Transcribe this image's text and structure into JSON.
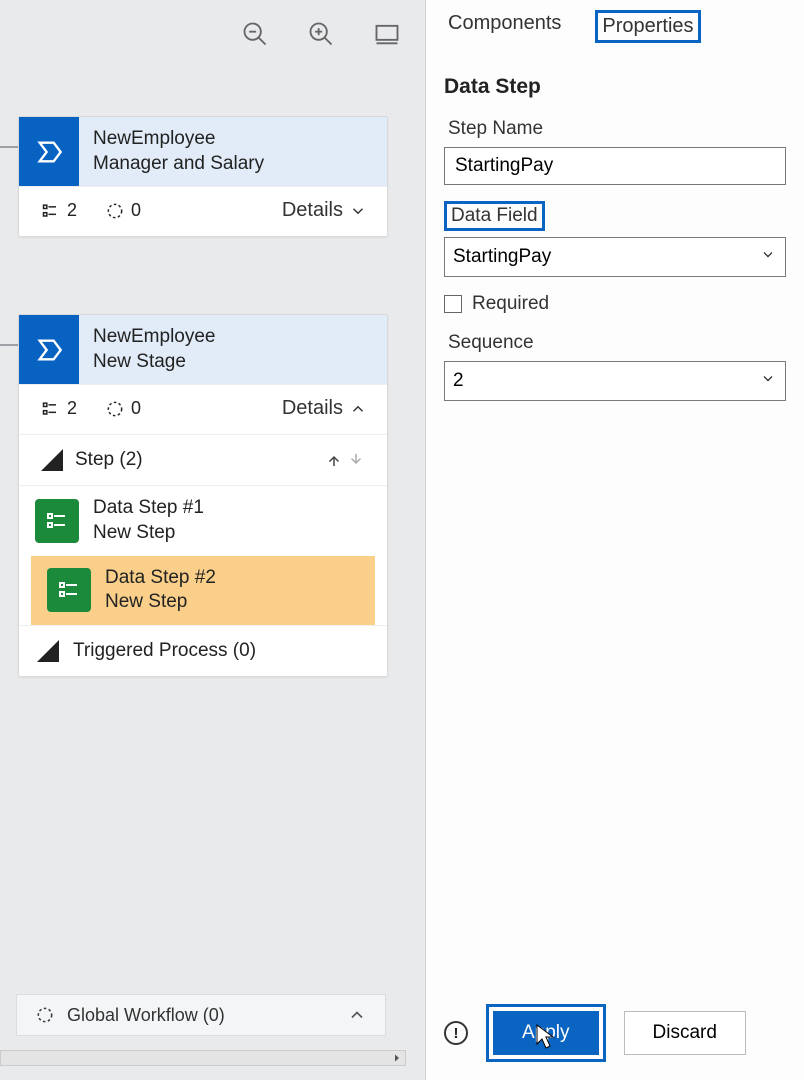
{
  "toolbar": {
    "zoom_out": "zoom-out",
    "zoom_in": "zoom-in",
    "fit": "fit"
  },
  "stages": [
    {
      "title1": "NewEmployee",
      "title2": "Manager and Salary",
      "steps_count": "2",
      "cycle_count": "0",
      "details_label": "Details"
    },
    {
      "title1": "NewEmployee",
      "title2": "New Stage",
      "steps_count": "2",
      "cycle_count": "0",
      "details_label": "Details",
      "step_header": "Step (2)",
      "data_step1_title": "Data Step #1",
      "data_step1_sub": "New Step",
      "data_step2_title": "Data Step #2",
      "data_step2_sub": "New Step",
      "triggered": "Triggered Process (0)"
    }
  ],
  "global_workflow": "Global Workflow (0)",
  "panel": {
    "tab_components": "Components",
    "tab_properties": "Properties",
    "section_title": "Data Step",
    "step_name_label": "Step Name",
    "step_name_value": "StartingPay",
    "data_field_label": "Data Field",
    "data_field_value": "StartingPay",
    "required_label": "Required",
    "sequence_label": "Sequence",
    "sequence_value": "2",
    "apply": "Apply",
    "discard": "Discard"
  }
}
